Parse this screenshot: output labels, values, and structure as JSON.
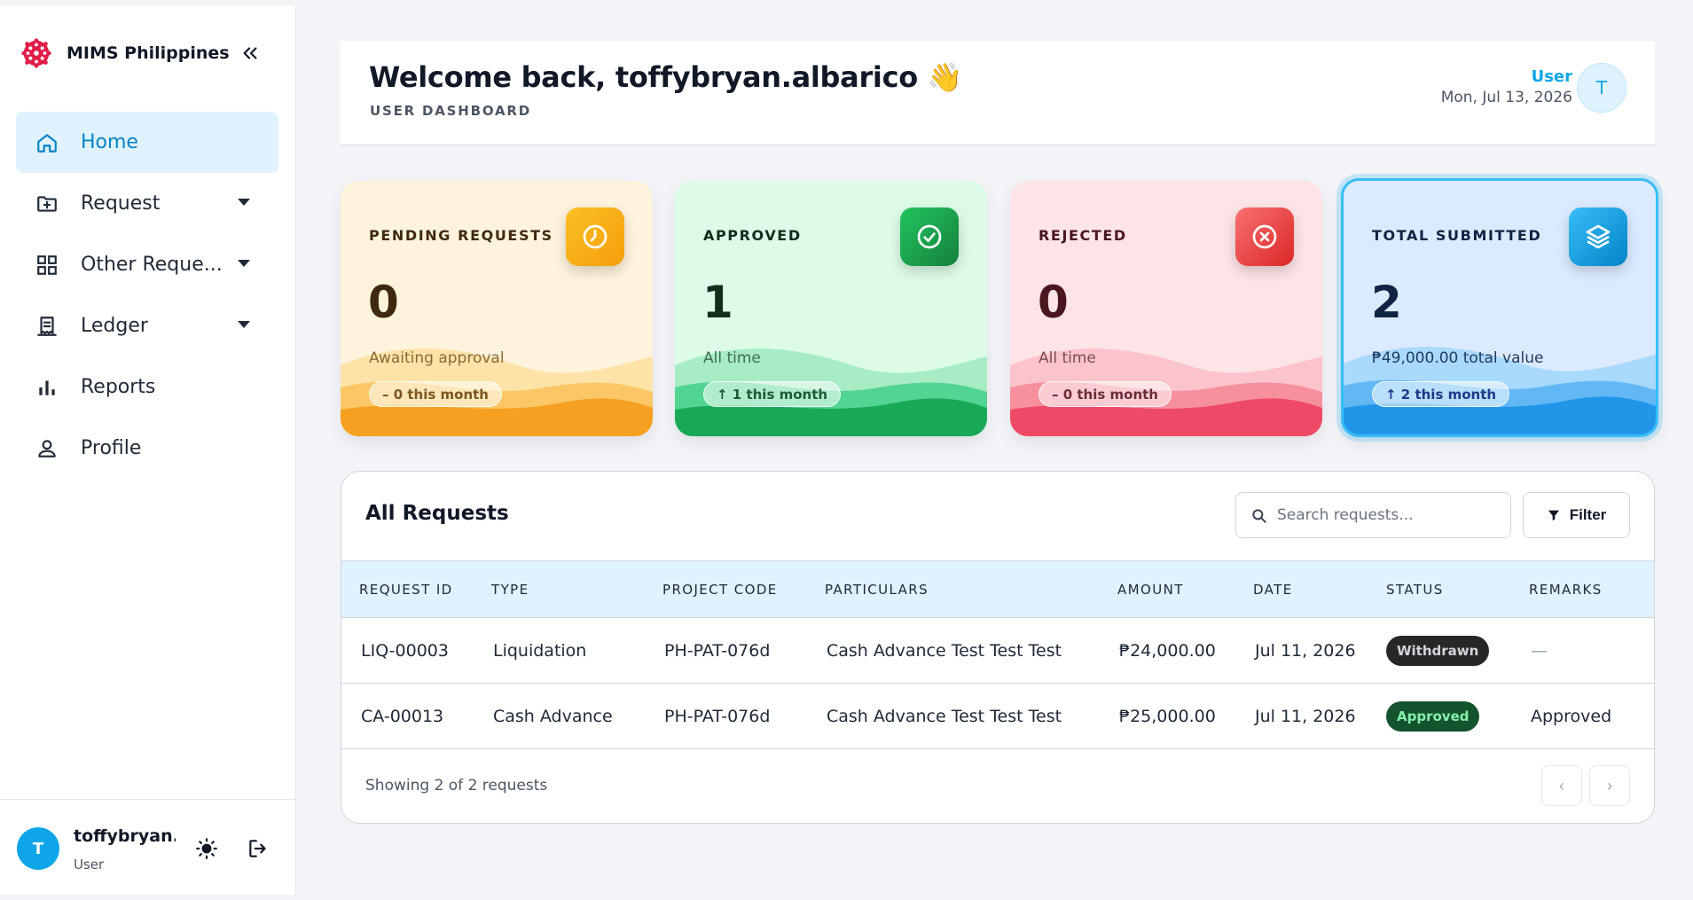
{
  "sidebar": {
    "brand_name": "MIMS Philippines",
    "items": [
      {
        "label": "Home",
        "icon": "home-icon",
        "active": true
      },
      {
        "label": "Request",
        "icon": "folder-plus-icon",
        "has_dropdown": true
      },
      {
        "label": "Other Reque...",
        "icon": "grid-icon",
        "has_dropdown": true
      },
      {
        "label": "Ledger",
        "icon": "receipt-icon",
        "has_dropdown": true
      },
      {
        "label": "Reports",
        "icon": "bar-chart-icon"
      },
      {
        "label": "Profile",
        "icon": "person-icon"
      }
    ],
    "user": {
      "initial": "T",
      "name": "toffybryan...",
      "role": "User"
    }
  },
  "header": {
    "welcome": "Welcome back, toffybryan.albarico 👋",
    "subtitle": "USER DASHBOARD",
    "role": "User",
    "date": "Mon, Jul 13, 2026",
    "avatar_initial": "T"
  },
  "stats": {
    "pending": {
      "title": "PENDING REQUESTS",
      "value": "0",
      "sub": "Awaiting approval",
      "pill": "– 0 this month",
      "icon": "clock-icon",
      "color": "#f59e0b"
    },
    "approved": {
      "title": "APPROVED",
      "value": "1",
      "sub": "All time",
      "pill": "↑ 1 this month",
      "icon": "check-circle-icon",
      "color": "#16a34a"
    },
    "rejected": {
      "title": "REJECTED",
      "value": "0",
      "sub": "All time",
      "pill": "– 0 this month",
      "icon": "x-circle-icon",
      "color": "#ef4444"
    },
    "total": {
      "title": "TOTAL SUBMITTED",
      "value": "2",
      "sub": "₱49,000.00 total value",
      "pill": "↑ 2 this month",
      "icon": "layers-icon",
      "color": "#0ea5e9"
    }
  },
  "requests": {
    "title": "All Requests",
    "search_placeholder": "Search requests...",
    "filter_label": "Filter",
    "columns": [
      "REQUEST ID",
      "TYPE",
      "PROJECT CODE",
      "PARTICULARS",
      "AMOUNT",
      "DATE",
      "STATUS",
      "REMARKS"
    ],
    "rows": [
      {
        "id": "LIQ-00003",
        "type": "Liquidation",
        "project_code": "PH-PAT-076d",
        "particulars": "Cash Advance Test Test Test",
        "amount": "₱24,000.00",
        "date": "Jul 11, 2026",
        "status": "Withdrawn",
        "remarks": "—"
      },
      {
        "id": "CA-00013",
        "type": "Cash Advance",
        "project_code": "PH-PAT-076d",
        "particulars": "Cash Advance Test Test Test",
        "amount": "₱25,000.00",
        "date": "Jul 11, 2026",
        "status": "Approved",
        "remarks": "Approved"
      }
    ],
    "footer_text": "Showing 2 of 2 requests",
    "prev_label": "‹",
    "next_label": "›"
  }
}
